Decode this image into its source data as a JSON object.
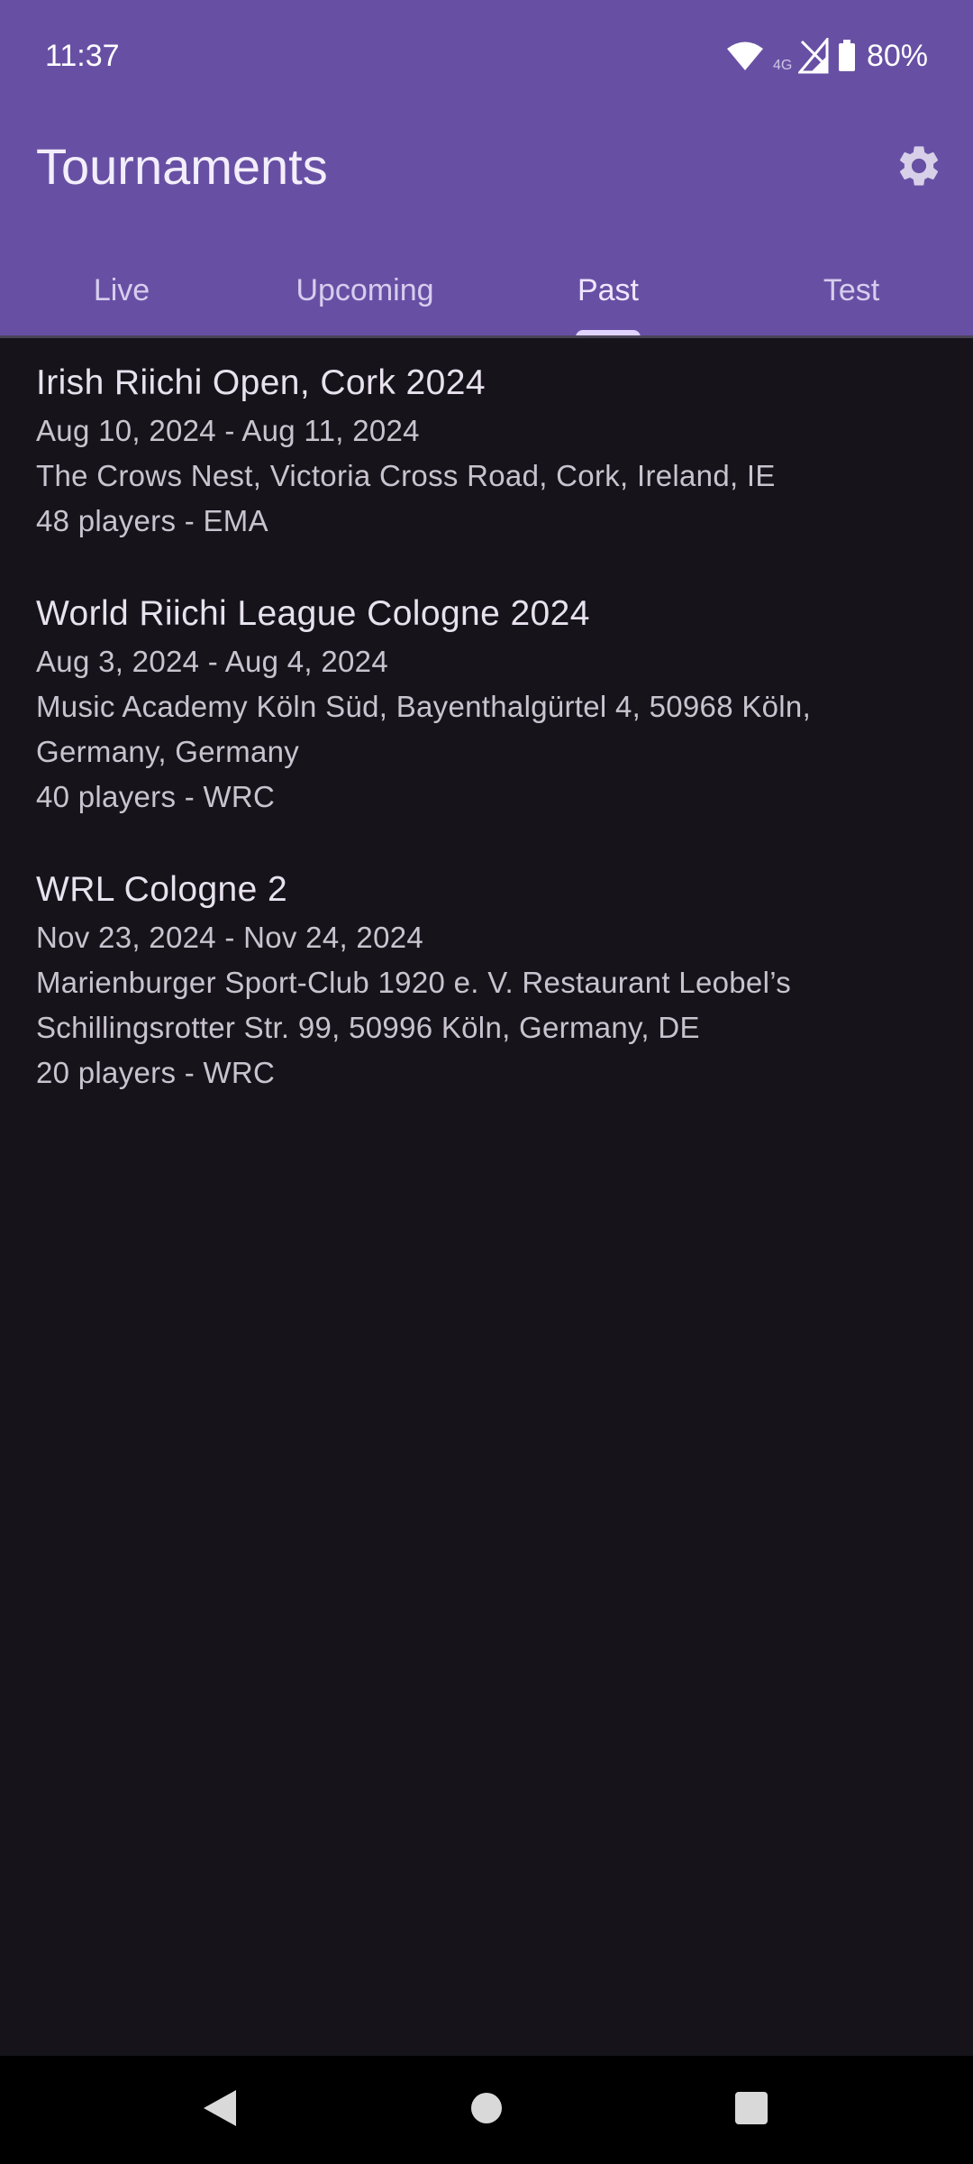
{
  "status_bar": {
    "time": "11:37",
    "network_label": "4G",
    "battery_percent": "80%",
    "icons": [
      "wifi-icon",
      "cell-signal-icon",
      "battery-icon"
    ]
  },
  "header": {
    "title": "Tournaments",
    "settings_icon": "gear-icon",
    "tabs": [
      {
        "label": "Live"
      },
      {
        "label": "Upcoming"
      },
      {
        "label": "Past"
      },
      {
        "label": "Test"
      }
    ],
    "active_tab": "Past"
  },
  "tournaments": [
    {
      "name": "Irish Riichi Open, Cork 2024",
      "dates": "Aug 10, 2024 - Aug 11, 2024",
      "location": "The Crows Nest, Victoria Cross Road, Cork, Ireland, IE",
      "players": "48 players - EMA"
    },
    {
      "name": "World Riichi League Cologne 2024",
      "dates": "Aug 3, 2024 - Aug 4, 2024",
      "location": "Music Academy Köln Süd, Bayenthalgürtel 4, 50968 Köln, Germany, Germany",
      "players": "40 players - WRC"
    },
    {
      "name": "WRL Cologne 2",
      "dates": "Nov 23, 2024 - Nov 24, 2024",
      "location": "Marienburger Sport-Club 1920 e. V. Restaurant Leobel’s Schillingsrotter Str. 99, 50996 Köln, Germany, DE",
      "players": "20 players - WRC"
    }
  ],
  "nav_bar": {
    "buttons": [
      "back-icon",
      "home-icon",
      "recents-icon"
    ]
  },
  "colors": {
    "app_bar": "#6750a4",
    "background": "#16141a",
    "indicator": "#e0d2ff"
  }
}
